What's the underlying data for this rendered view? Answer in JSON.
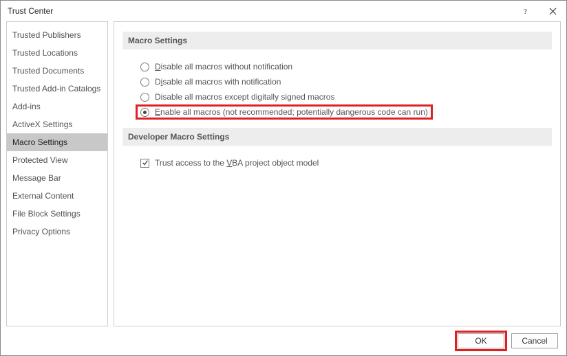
{
  "window": {
    "title": "Trust Center"
  },
  "sidebar": {
    "items": [
      {
        "label": "Trusted Publishers"
      },
      {
        "label": "Trusted Locations"
      },
      {
        "label": "Trusted Documents"
      },
      {
        "label": "Trusted Add-in Catalogs"
      },
      {
        "label": "Add-ins"
      },
      {
        "label": "ActiveX Settings"
      },
      {
        "label": "Macro Settings"
      },
      {
        "label": "Protected View"
      },
      {
        "label": "Message Bar"
      },
      {
        "label": "External Content"
      },
      {
        "label": "File Block Settings"
      },
      {
        "label": "Privacy Options"
      }
    ],
    "selected_index": 6
  },
  "sections": {
    "macro_header": "Macro Settings",
    "dev_header": "Developer Macro Settings"
  },
  "radios": {
    "opt1_pre": "",
    "opt1_accel": "D",
    "opt1_post": "isable all macros without notification",
    "opt2_pre": "D",
    "opt2_accel": "i",
    "opt2_post": "sable all macros with notification",
    "opt3_pre": "Disable all macros except di",
    "opt3_accel": "g",
    "opt3_post": "itally signed macros",
    "opt4_pre": "",
    "opt4_accel": "E",
    "opt4_post": "nable all macros (not recommended; potentially dangerous code can run)",
    "selected_index": 3
  },
  "checkbox": {
    "pre": "Trust access to the ",
    "accel": "V",
    "post": "BA project object model",
    "checked": true
  },
  "buttons": {
    "ok": "OK",
    "cancel": "Cancel"
  }
}
